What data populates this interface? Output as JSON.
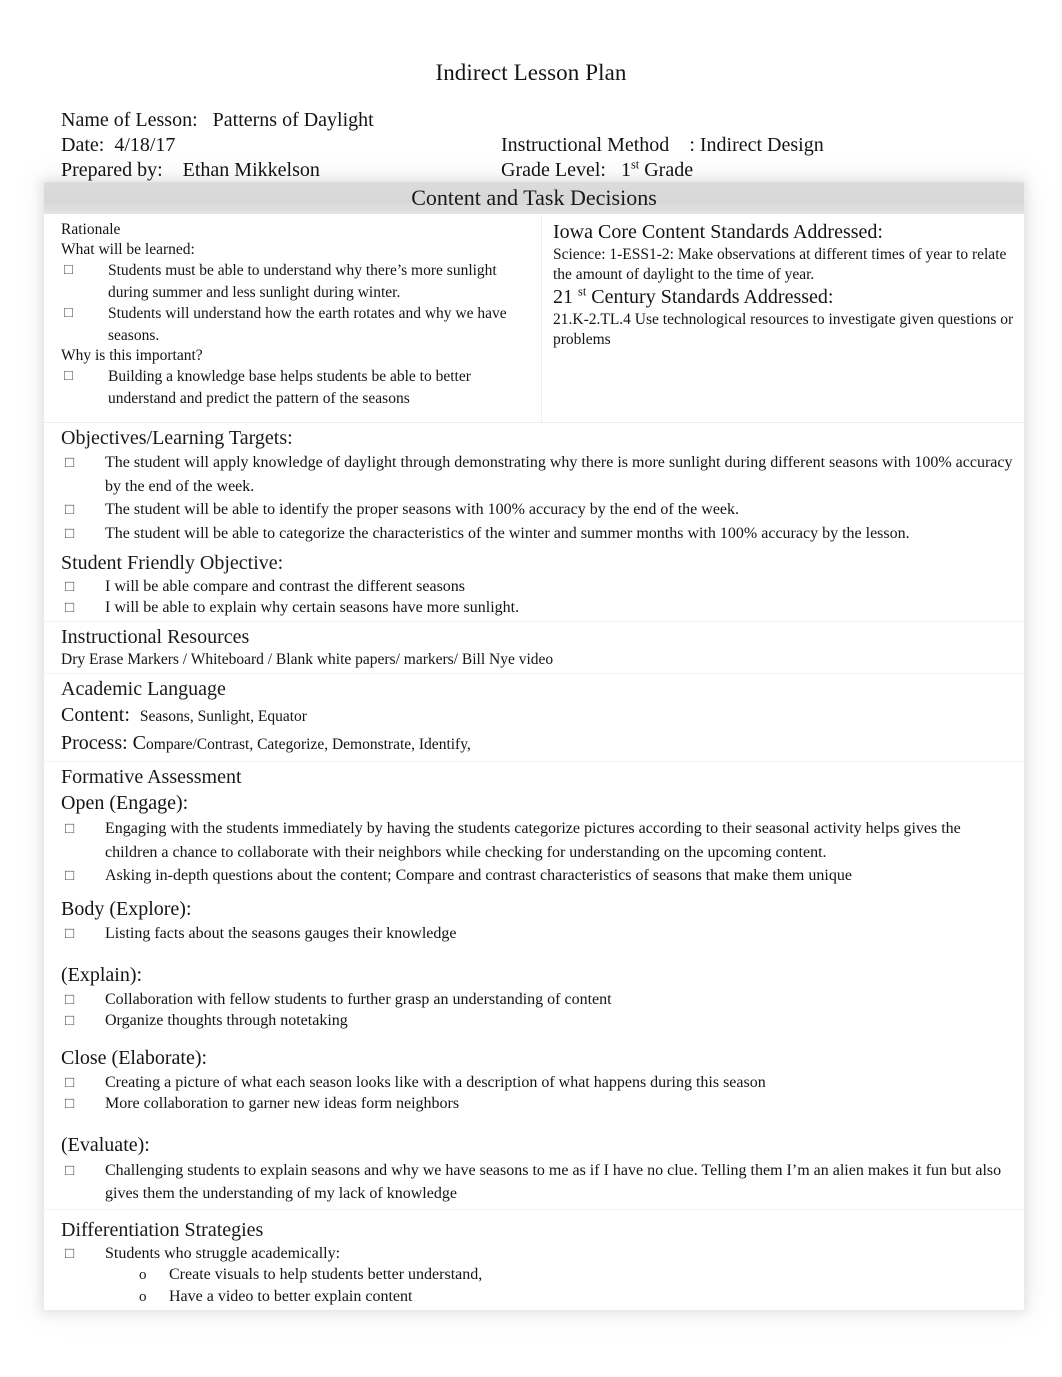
{
  "document": {
    "title": "Indirect Lesson Plan"
  },
  "header": {
    "name_label": "Name of Lesson:",
    "name_value": "Patterns of Daylight",
    "date_label": "Date:",
    "date_value": "4/18/17",
    "method_label": "Instructional Method",
    "method_value": ": Indirect Design",
    "prepared_label": "Prepared by:",
    "prepared_value": "Ethan Mikkelson",
    "grade_label": "Grade Level:",
    "grade_number": "1",
    "grade_ordinal": "st",
    "grade_word": "Grade"
  },
  "band": {
    "title": "Content and Task Decisions"
  },
  "rationale": {
    "heading": "Rationale",
    "what_label": "What will be learned:",
    "what_items": [
      "Students must be able to understand why there’s more sunlight during summer and less sunlight during winter.",
      "Students will understand how the earth rotates and why we have seasons."
    ],
    "why_label": "Why is this important?",
    "why_items": [
      "Building a knowledge base helps students be able to better understand and predict the pattern of the seasons"
    ]
  },
  "standards": {
    "iowa_heading": "Iowa Core Content Standards Addressed:",
    "iowa_text": "Science: 1-ESS1-2: Make observations at different times of year to relate the amount of daylight to the time of year.",
    "century_number": "21",
    "century_ordinal": "st",
    "century_heading_rest": "Century Standards Addressed:",
    "century_text": "21.K-2.TL.4 Use technological resources to investigate given questions or problems"
  },
  "objectives": {
    "heading": "Objectives/Learning Targets:",
    "items": [
      "The student will apply knowledge of daylight through demonstrating why there is more sunlight during different seasons with 100% accuracy by the end of the week.",
      "The student will be able to identify the proper seasons with 100% accuracy by the end of the week.",
      "The student will be able to categorize the characteristics of the winter and summer months with 100% accuracy by the lesson."
    ]
  },
  "student_friendly": {
    "heading": "Student Friendly Objective:",
    "items": [
      "I will be able compare and contrast the different seasons",
      "I will be able to explain why certain seasons have more sunlight."
    ]
  },
  "resources": {
    "heading": "Instructional Resources",
    "text": "Dry Erase Markers / Whiteboard / Blank white papers/ markers/ Bill Nye video"
  },
  "academic_language": {
    "heading": "Academic Language",
    "content_label": "Content:",
    "content_value": "Seasons, Sunlight, Equator",
    "process_label": "Process:",
    "process_cap": "C",
    "process_rest": "ompare/Contrast, Categorize, Demonstrate, Identify,"
  },
  "formative": {
    "heading": "Formative Assessment",
    "open_heading": "Open (Engage):",
    "open_items": [
      "Engaging with the students immediately by having the students categorize pictures according to their seasonal activity helps gives the children a chance to collaborate with their neighbors while checking for understanding on the upcoming content.",
      "Asking in-depth questions about the content; Compare and contrast characteristics of seasons that make them unique"
    ],
    "body_heading": "Body (Explore):",
    "body_items": [
      "Listing facts about the seasons gauges their knowledge"
    ],
    "explain_heading": "(Explain):",
    "explain_items": [
      "Collaboration with fellow students to further grasp an understanding of content",
      "Organize thoughts through notetaking"
    ],
    "close_heading": "Close (Elaborate):",
    "close_items": [
      "Creating a picture of what each season looks like with a description of what happens during this season",
      "More collaboration to garner new ideas form neighbors"
    ],
    "evaluate_heading": "(Evaluate):",
    "evaluate_items": [
      "Challenging students to explain seasons and why we have seasons to me as if I have no clue. Telling them I’m an alien makes it fun but also gives them the understanding of my lack of knowledge"
    ]
  },
  "differentiation": {
    "heading": "Differentiation Strategies",
    "items": [
      "Students who struggle academically:"
    ],
    "sub_items": [
      "Create visuals to help students better understand,",
      "Have a video to better explain content"
    ]
  }
}
